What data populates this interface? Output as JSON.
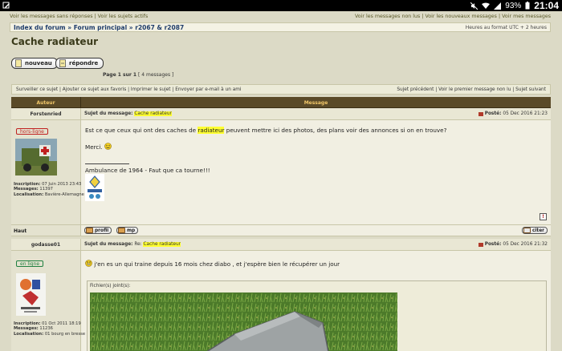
{
  "statusbar": {
    "battery": "93%",
    "time": "21:04"
  },
  "toplinks": {
    "left": [
      "Voir les messages sans réponses",
      "Voir les sujets actifs"
    ],
    "right": [
      "Voir les messages non lus",
      "Voir les nouveaux messages",
      "Voir mes messages"
    ]
  },
  "nav": {
    "crumbs": [
      "Index du forum",
      "Forum principal",
      "r2067 & r2087"
    ],
    "timezone": "Heures au format UTC + 2 heures"
  },
  "title": "Cache radiateur",
  "buttons": {
    "new": "nouveau",
    "reply": "répondre"
  },
  "pageinfo": {
    "page": "Page 1 sur 1",
    "count": "[ 4 messages ]"
  },
  "toolbar": {
    "left": [
      "Surveiller ce sujet",
      "Ajouter ce sujet aux favoris",
      "Imprimer le sujet",
      "Envoyer par e-mail à un ami"
    ],
    "right": [
      "Sujet précédent",
      "Voir le premier message non lu",
      "Sujet suivant"
    ]
  },
  "table": {
    "col_author": "Auteur",
    "col_message": "Message"
  },
  "posts": [
    {
      "author": "Forstenried",
      "status": "hors-ligne",
      "subject_label": "Sujet du message:",
      "subject": "Cache radiateur",
      "posted_label": "Posté:",
      "posted": "05 Dec 2016 21:23",
      "info": [
        {
          "k": "Inscription:",
          "v": "07 Juin 2013 23:43"
        },
        {
          "k": "Messages:",
          "v": "11397"
        },
        {
          "k": "Localisation:",
          "v": "Bavière-Allemagne"
        }
      ],
      "text_pre": "Est ce que ceux qui ont des caches de ",
      "text_hl": "radiateur",
      "text_post": " peuvent mettre ici des photos, des plans voir des annonces si on en trouve?",
      "thanks": "Merci.",
      "signature": "Ambulance de 1964 - Faut que ca tourne!!!",
      "haut": "Haut",
      "btn_profile": "profil",
      "btn_mp": "mp",
      "btn_quote": "citer"
    },
    {
      "author": "godasse01",
      "status": "en ligne",
      "subject_label": "Sujet du message:",
      "subject_prefix": "Re:",
      "subject": "Cache radiateur",
      "posted_label": "Posté:",
      "posted": "05 Dec 2016 21:32",
      "info": [
        {
          "k": "Inscription:",
          "v": "01 Oct 2011 18:19"
        },
        {
          "k": "Messages:",
          "v": "11236"
        },
        {
          "k": "Localisation:",
          "v": "01 bourg en bresse"
        }
      ],
      "text": "j'en es un qui traine depuis 16 mois chez diabo , et j'espère bien le récupérer un jour",
      "attach_label": "Fichier(s) joint(s):"
    }
  ]
}
